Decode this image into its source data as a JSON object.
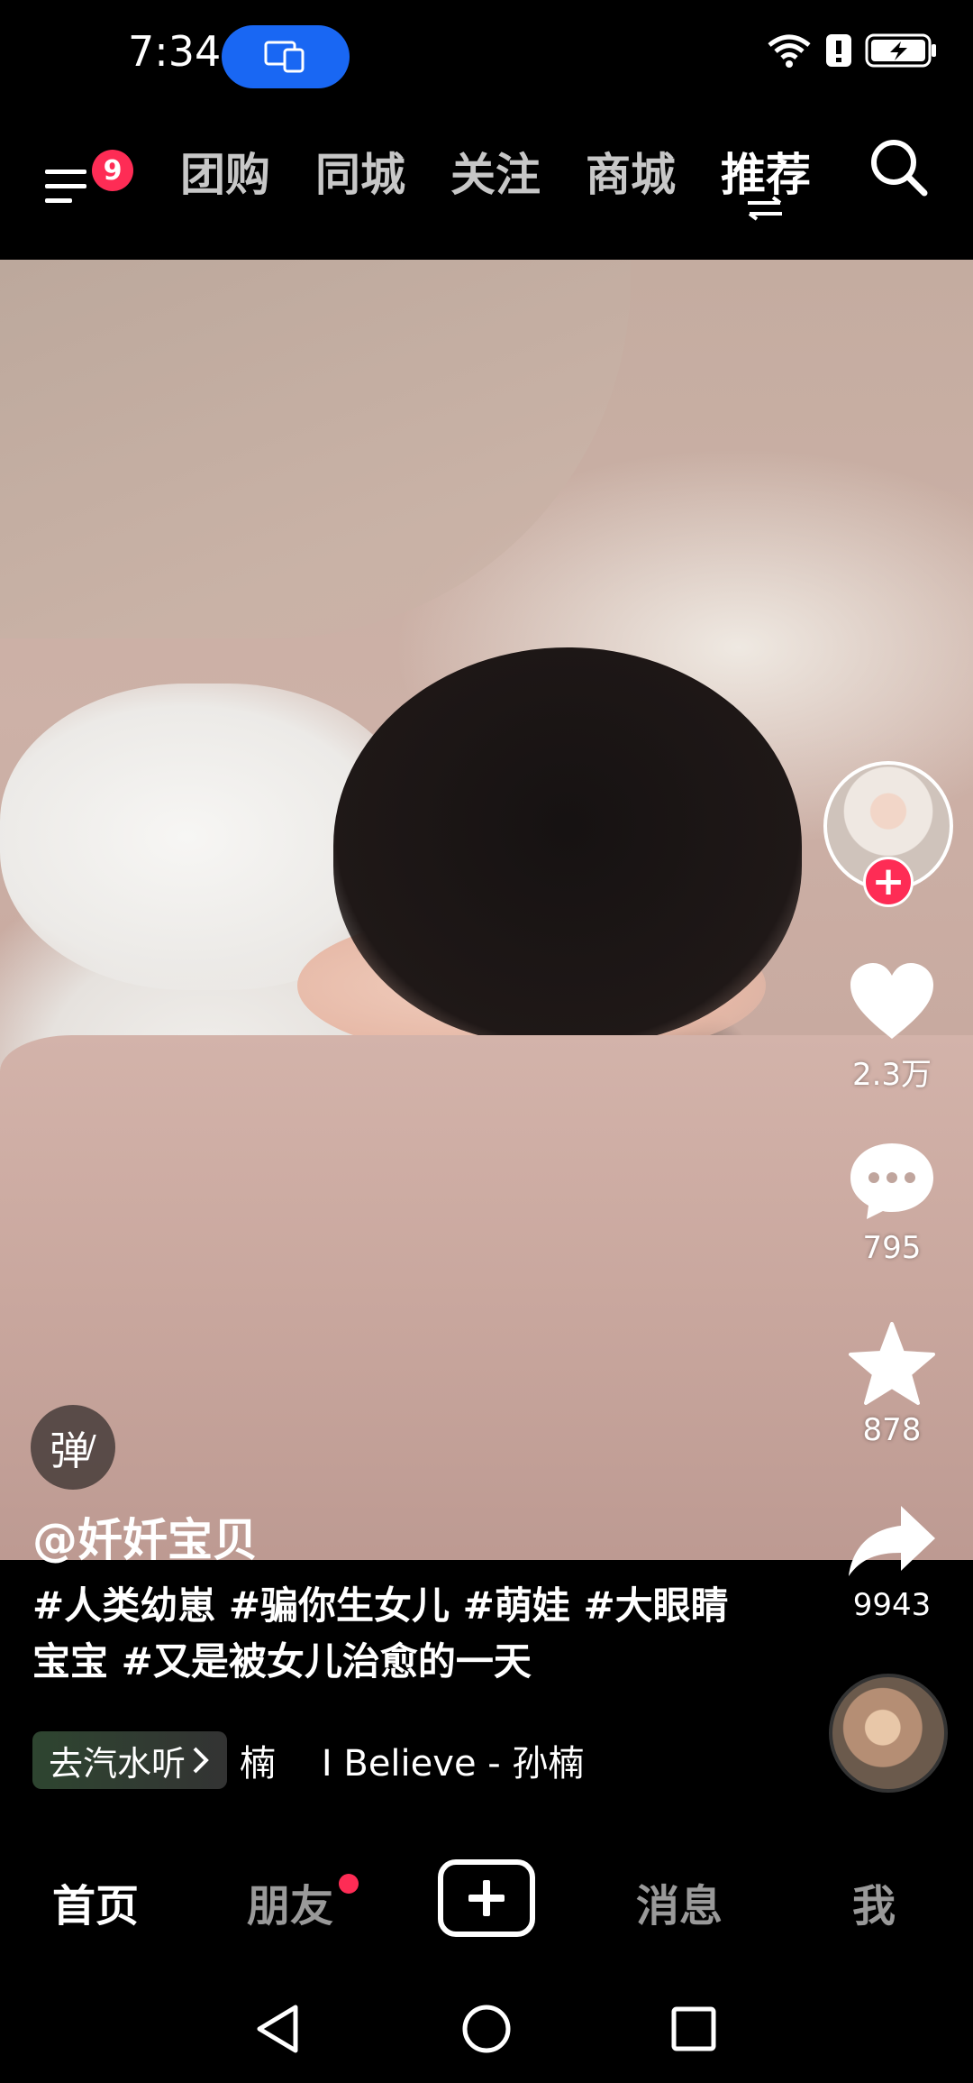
{
  "status_bar": {
    "time": "7:34",
    "icons": [
      "screen-share-icon",
      "wifi-icon",
      "alert-icon",
      "battery-charging-icon"
    ]
  },
  "top_nav": {
    "menu_badge": "9",
    "tabs": [
      "团购",
      "同城",
      "关注",
      "商城",
      "推荐"
    ],
    "active_tab": "推荐"
  },
  "video": {
    "author": "@奷奷宝贝",
    "description": "#人类幼崽 #骗你生女儿 #萌娃 #大眼睛宝宝 #又是被女儿治愈的一天",
    "danmu_label": "弹",
    "music": {
      "app_link": "去汽水听",
      "track": "楠    I Believe - 孙楠"
    }
  },
  "right_rail": {
    "likes": "2.3万",
    "comments": "795",
    "favorites": "878",
    "shares": "9943"
  },
  "bottom_nav": {
    "tabs": [
      "首页",
      "朋友",
      "消息",
      "我"
    ],
    "active_tab": "首页"
  }
}
